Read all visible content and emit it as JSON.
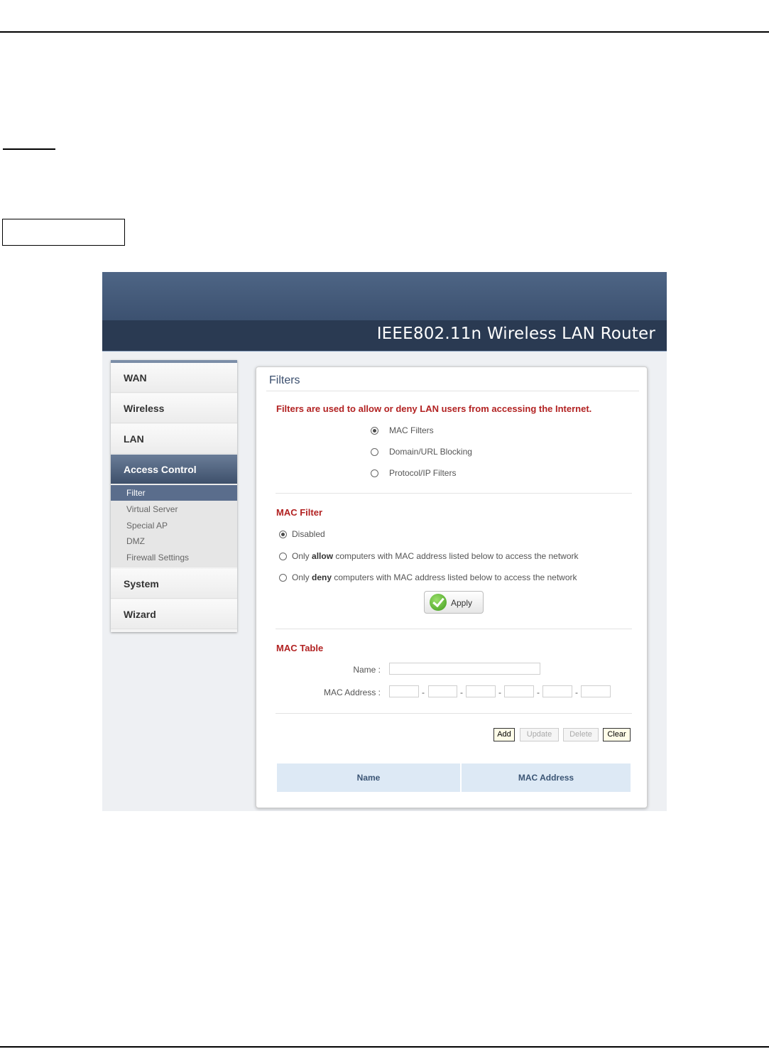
{
  "header": {
    "title": "IEEE802.11n  Wireless LAN Router"
  },
  "sidebar": {
    "items": [
      {
        "label": "WAN"
      },
      {
        "label": "Wireless"
      },
      {
        "label": "LAN"
      },
      {
        "label": "Access Control",
        "active": true
      },
      {
        "label": "System"
      },
      {
        "label": "Wizard"
      }
    ],
    "submenu": [
      {
        "label": "Filter",
        "active": true
      },
      {
        "label": "Virtual Server"
      },
      {
        "label": "Special AP"
      },
      {
        "label": "DMZ"
      },
      {
        "label": "Firewall Settings"
      }
    ]
  },
  "panel": {
    "title": "Filters",
    "intro": "Filters are used to allow or deny LAN users from accessing the Internet.",
    "filter_types": [
      {
        "label": "MAC Filters",
        "selected": true
      },
      {
        "label": "Domain/URL Blocking",
        "selected": false
      },
      {
        "label": "Protocol/IP Filters",
        "selected": false
      }
    ],
    "mac_filter": {
      "heading": "MAC Filter",
      "options": {
        "disabled": "Disabled",
        "allow_prefix": "Only ",
        "allow_bold": "allow",
        "allow_suffix": " computers with MAC address listed below to access the network",
        "deny_prefix": "Only ",
        "deny_bold": "deny",
        "deny_suffix": " computers with MAC address listed below to access the network"
      },
      "selected": "disabled",
      "apply_label": "Apply"
    },
    "mac_table": {
      "heading": "MAC Table",
      "name_label": "Name :",
      "name_value": "",
      "mac_label": "MAC Address :",
      "separator": "-",
      "mac_octets": [
        "",
        "",
        "",
        "",
        "",
        ""
      ]
    },
    "buttons": {
      "add": "Add",
      "update": "Update",
      "delete": "Delete",
      "clear": "Clear"
    },
    "table": {
      "columns": [
        "Name",
        "MAC Address"
      ],
      "rows": []
    }
  },
  "colors": {
    "accent_red": "#b22222",
    "banner": "#2a3a52",
    "menu_active": "#3e506b"
  }
}
